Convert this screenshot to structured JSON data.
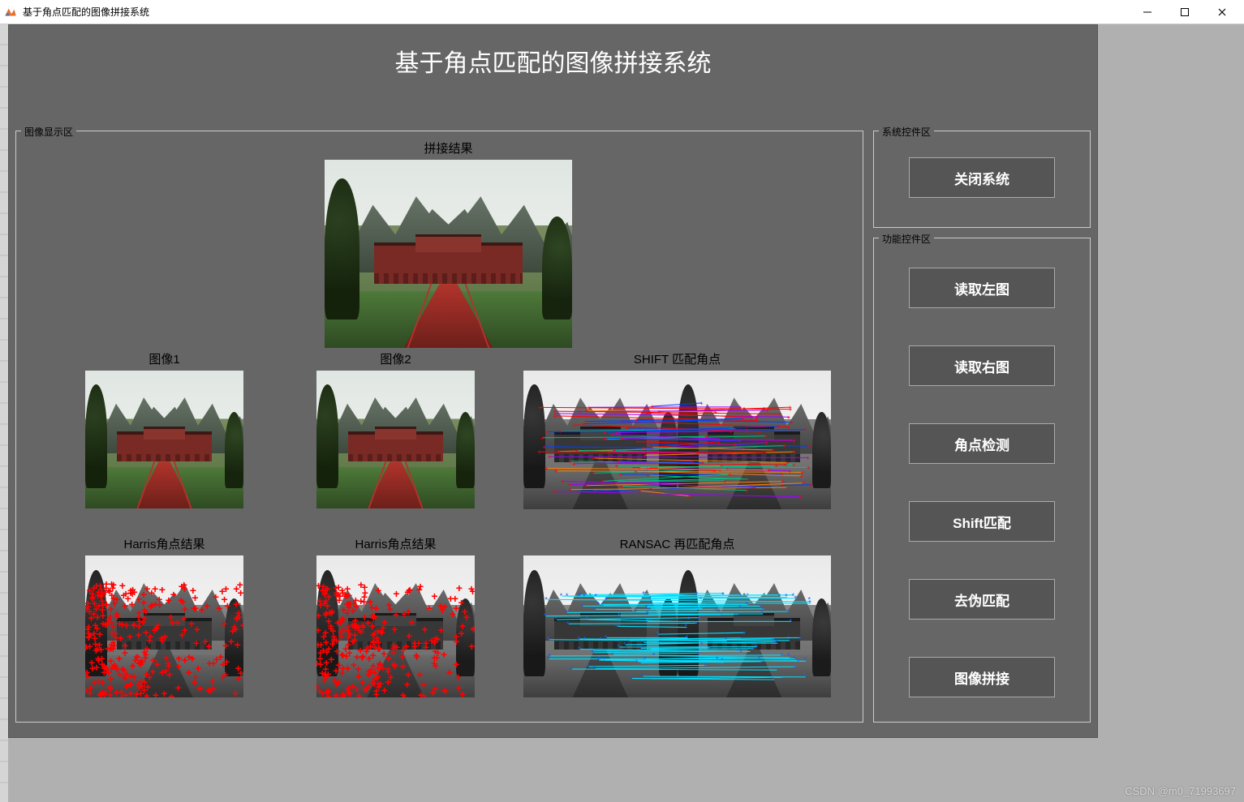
{
  "window": {
    "title": "基于角点匹配的图像拼接系统"
  },
  "header": {
    "main_title": "基于角点匹配的图像拼接系统"
  },
  "display": {
    "group_label": "图像显示区",
    "stitch_title": "拼接结果",
    "image1_title": "图像1",
    "image2_title": "图像2",
    "shift_title": "SHIFT 匹配角点",
    "harris1_title": "Harris角点结果",
    "harris2_title": "Harris角点结果",
    "ransac_title": "RANSAC 再匹配角点"
  },
  "sys_controls": {
    "group_label": "系统控件区",
    "close_label": "关闭系统"
  },
  "func_controls": {
    "group_label": "功能控件区",
    "load_left": "读取左图",
    "load_right": "读取右图",
    "corner_detect": "角点检测",
    "shift_match": "Shift匹配",
    "remove_false": "去伪匹配",
    "stitch": "图像拼接"
  },
  "colors": {
    "app_bg": "#666666",
    "button_bg": "#555555",
    "border": "#cccccc",
    "harris_mark": "#ff0000",
    "shift_lines": [
      "#ff0000",
      "#0040ff",
      "#ff8000",
      "#a000ff",
      "#00c080"
    ],
    "ransac_lines": "#00e0ff"
  },
  "watermark": "CSDN @m0_71993697"
}
